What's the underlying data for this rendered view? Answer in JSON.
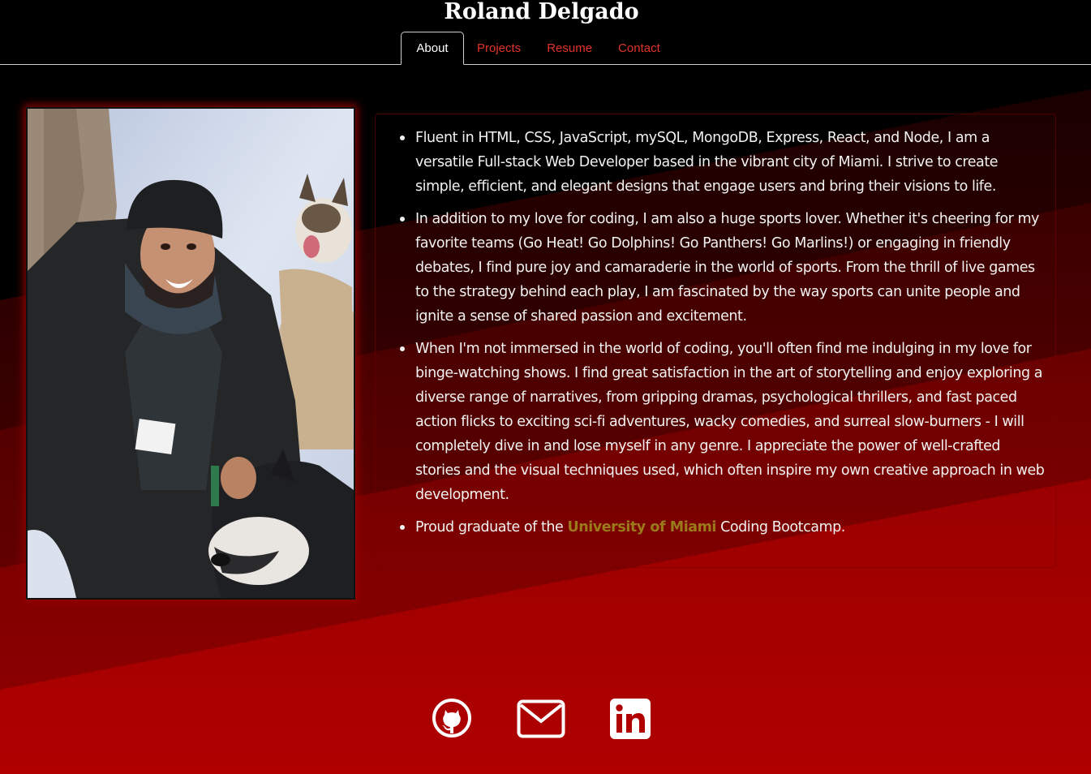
{
  "header": {
    "title": "Roland Delgado",
    "tabs": [
      {
        "label": "About",
        "active": true
      },
      {
        "label": "Projects",
        "active": false
      },
      {
        "label": "Resume",
        "active": false
      },
      {
        "label": "Contact",
        "active": false
      }
    ]
  },
  "about": {
    "photo_alt": "Roland Delgado with husky dogs in the snow",
    "bullets": [
      "Fluent in HTML, CSS, JavaScript, mySQL, MongoDB, Express, React, and Node, I am a versatile Full-stack Web Developer based in the vibrant city of Miami. I strive to create simple, efficient, and elegant designs that engage users and bring their visions to life.",
      "In addition to my love for coding, I am also a huge sports lover. Whether it's cheering for my favorite teams (Go Heat! Go Dolphins! Go Panthers! Go Marlins!) or engaging in friendly debates, I find pure joy and camaraderie in the world of sports. From the thrill of live games to the strategy behind each play, I am fascinated by the way sports can unite people and ignite a sense of shared passion and excitement.",
      "When I'm not immersed in the world of coding, you'll often find me indulging in my love for binge-watching shows. I find great satisfaction in the art of storytelling and enjoy exploring a diverse range of narratives, from gripping dramas, psychological thrillers, and fast paced action flicks to exciting sci-fi adventures, wacky comedies, and surreal slow-burners - I will completely dive in and lose myself in any genre. I appreciate the power of well-crafted stories and the visual techniques used, which often inspire my own creative approach in web development."
    ],
    "graduate": {
      "prefix": "Proud graduate of the ",
      "school": "University of Miami",
      "suffix": " Coding Bootcamp."
    }
  },
  "socials": [
    {
      "icon": "github-icon",
      "label": "GitHub"
    },
    {
      "icon": "envelope-icon",
      "label": "Email"
    },
    {
      "icon": "linkedin-icon",
      "label": "LinkedIn"
    }
  ],
  "colors": {
    "background": "#000000",
    "accent_red": "#e0332b",
    "band_red": "#b00000",
    "school_gold": "#9a7a1a",
    "text": "#f1f1f1"
  }
}
